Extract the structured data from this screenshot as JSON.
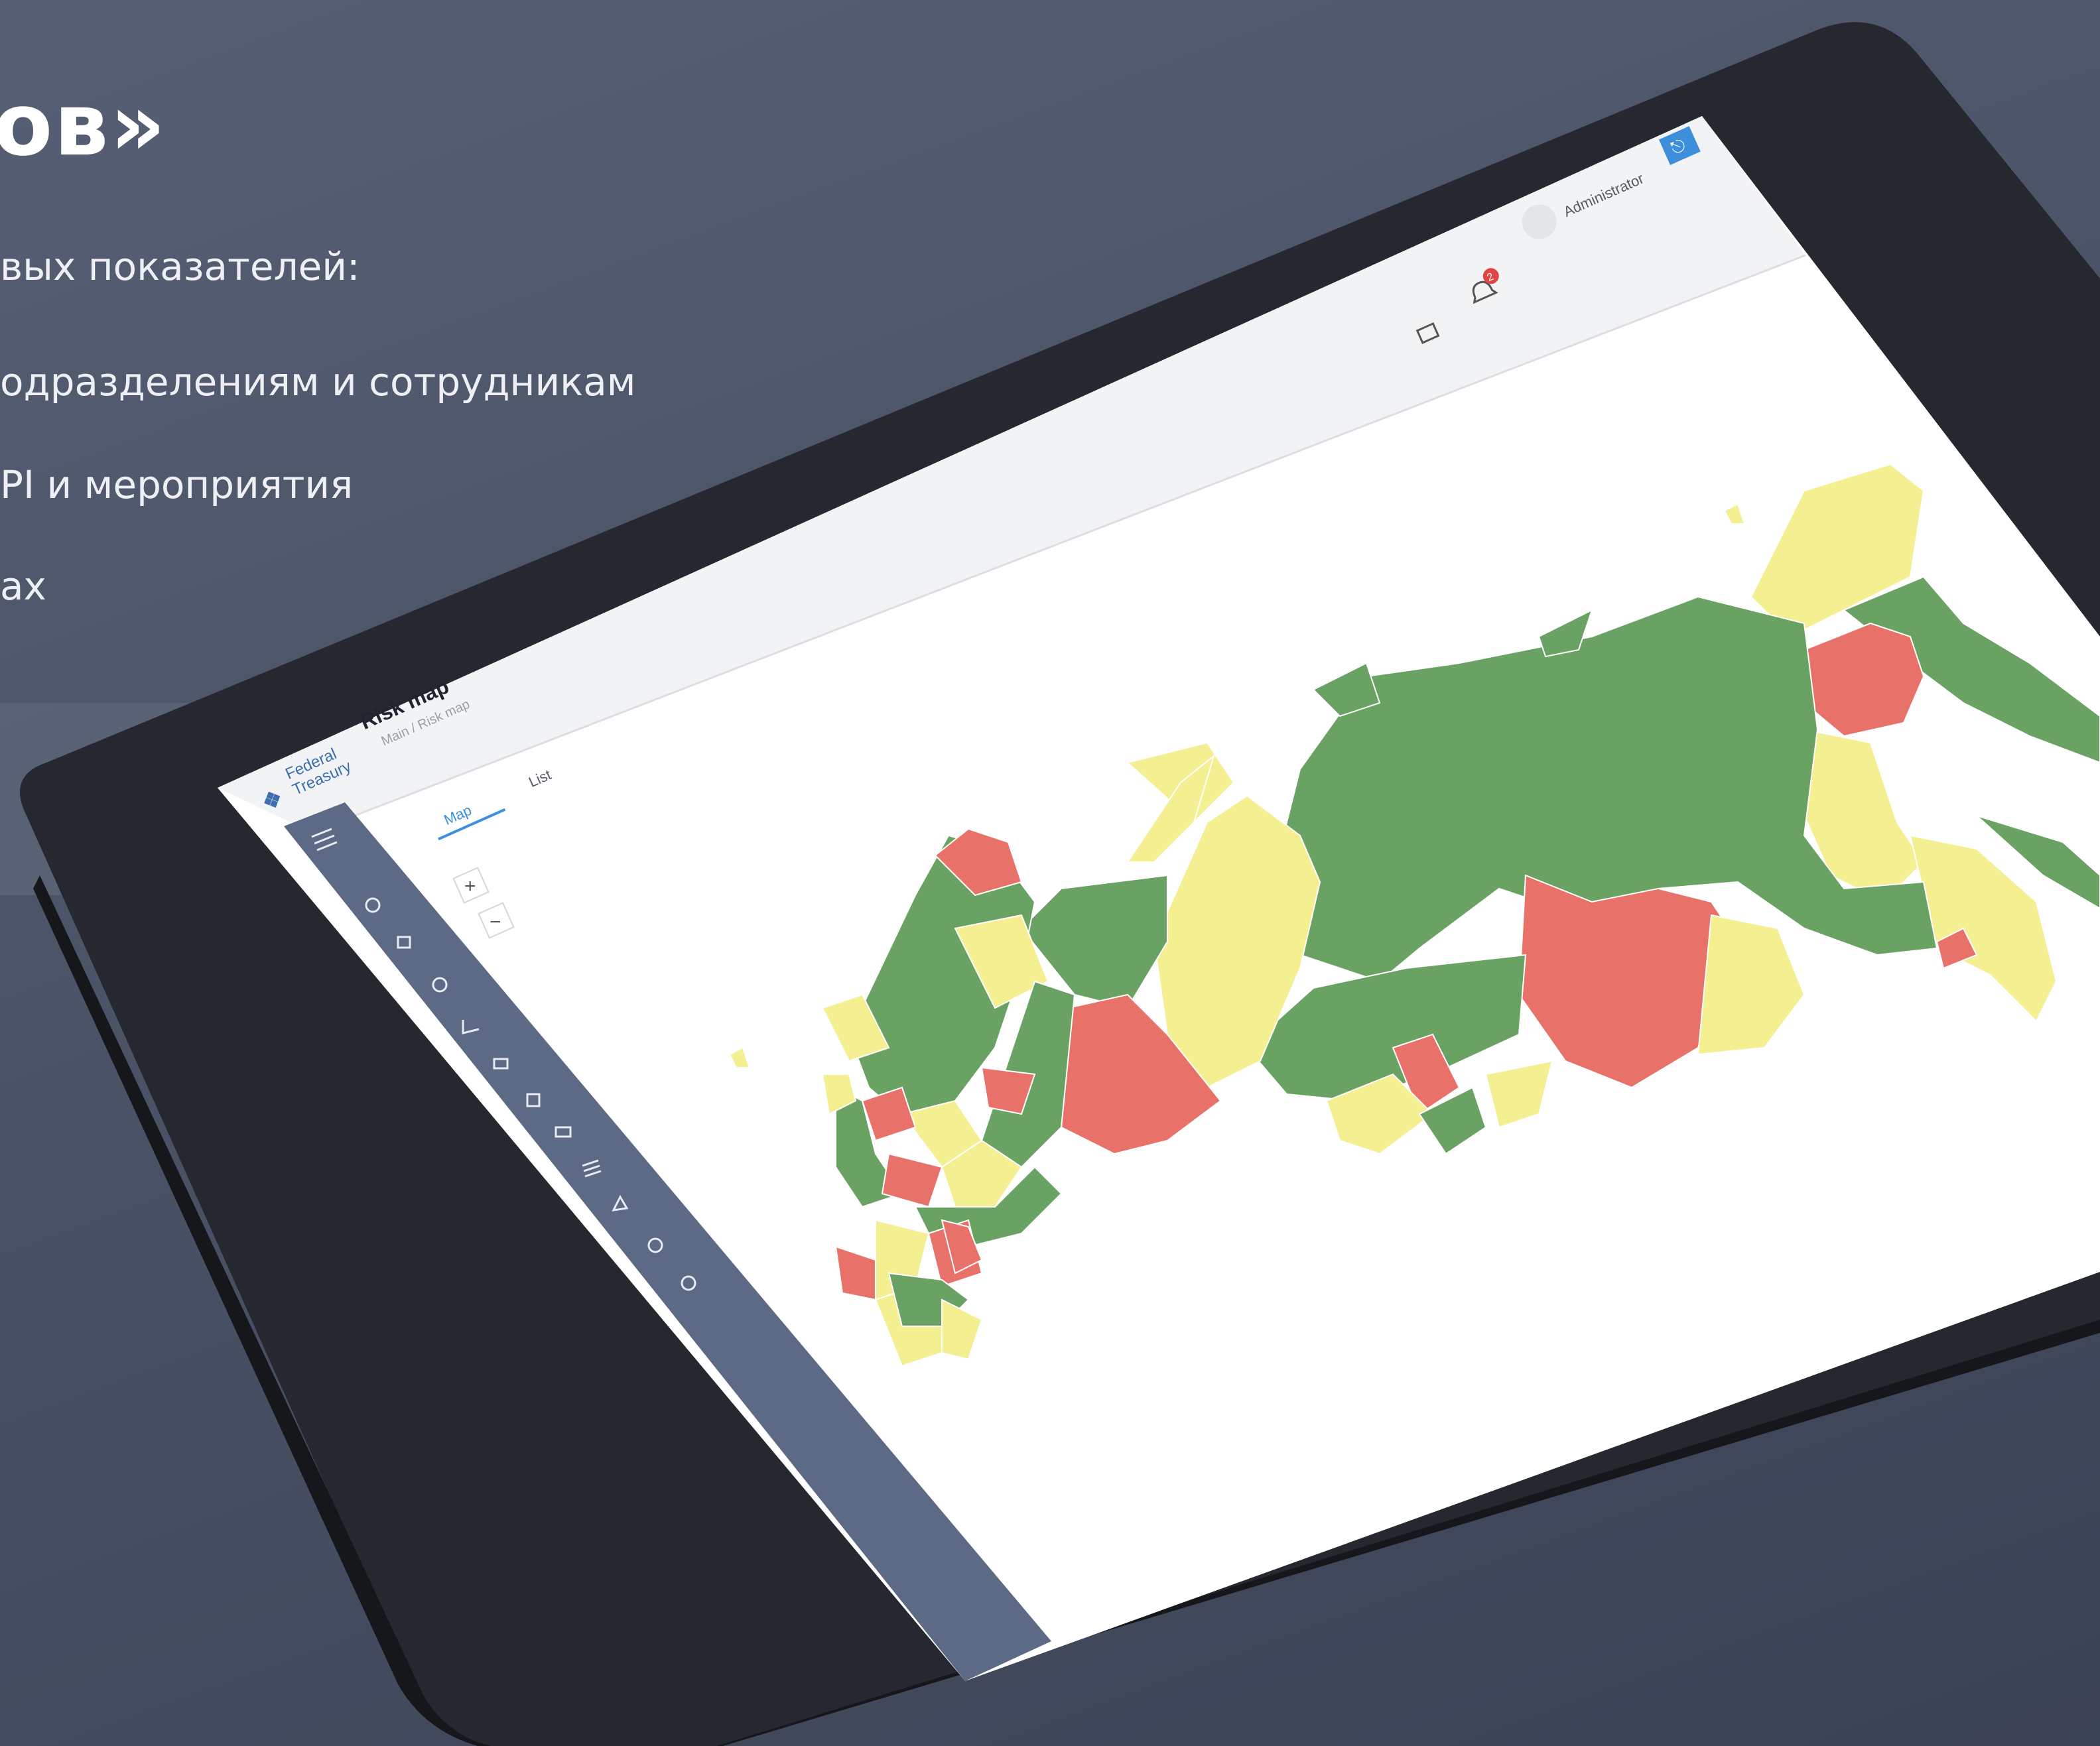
{
  "slide": {
    "heading": "ов»",
    "bullets": [
      "вых показателей:",
      "одразделениям и сотрудникам",
      "PI и мероприятия",
      "ах"
    ]
  },
  "app": {
    "logo_line1": "Federal",
    "logo_line2": "Treasury",
    "page_title": "Risk map",
    "breadcrumb": "Main / Risk map",
    "tabs": [
      {
        "label": "Map",
        "active": true
      },
      {
        "label": "List",
        "active": false
      }
    ],
    "user_name": "Administrator",
    "notification_count": "2",
    "map_zoom_in": "+",
    "map_zoom_out": "−"
  },
  "colors": {
    "risk_high": "#e8716a",
    "risk_medium": "#f4ef91",
    "risk_low": "#6aa264",
    "sidebar": "#5d6a86",
    "accent": "#3d8fdb"
  }
}
